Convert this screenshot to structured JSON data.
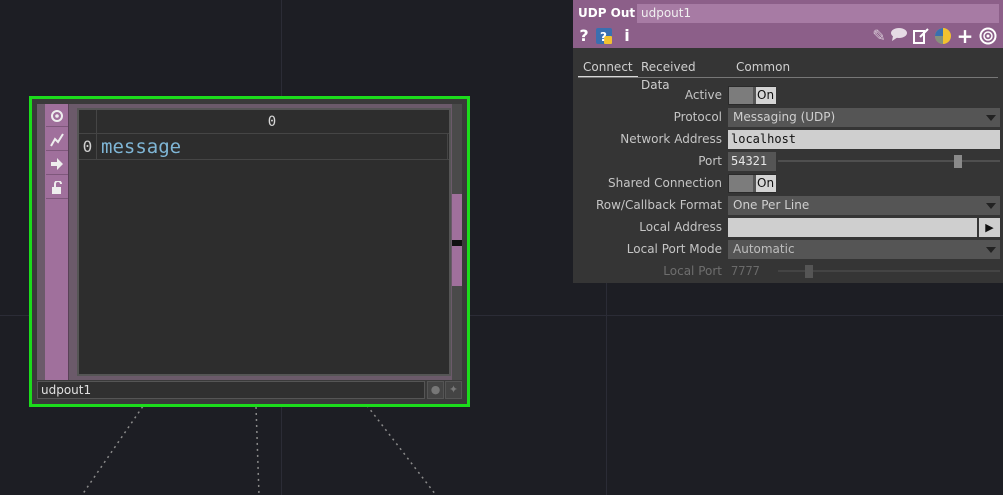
{
  "node": {
    "name": "udpout1",
    "table": {
      "column_header": "0",
      "rows": [
        {
          "index": "0",
          "value": "message"
        }
      ]
    },
    "left_buttons": [
      "viewer-toggle-icon",
      "export-flag-icon",
      "bypass-arrow-icon",
      "lock-icon"
    ]
  },
  "panel": {
    "op_type": "UDP Out",
    "op_name": "udpout1",
    "tabs": [
      "Connect",
      "Received Data",
      "Common"
    ],
    "active_tab": "Connect",
    "params": {
      "active": {
        "label": "Active",
        "value": "On"
      },
      "protocol": {
        "label": "Protocol",
        "value": "Messaging (UDP)"
      },
      "network_address": {
        "label": "Network Address",
        "value": "localhost"
      },
      "port": {
        "label": "Port",
        "value": "54321"
      },
      "shared_connection": {
        "label": "Shared Connection",
        "value": "On"
      },
      "row_callback_format": {
        "label": "Row/Callback Format",
        "value": "One Per Line"
      },
      "local_address": {
        "label": "Local Address",
        "value": ""
      },
      "local_port_mode": {
        "label": "Local Port Mode",
        "value": "Automatic"
      },
      "local_port": {
        "label": "Local Port",
        "value": "7777"
      }
    }
  },
  "colors": {
    "background": "#1d1e24",
    "node_selected_border": "#1cdc1c",
    "dat_purple": "#8c5f89",
    "cell_text": "#7fb6d6"
  }
}
